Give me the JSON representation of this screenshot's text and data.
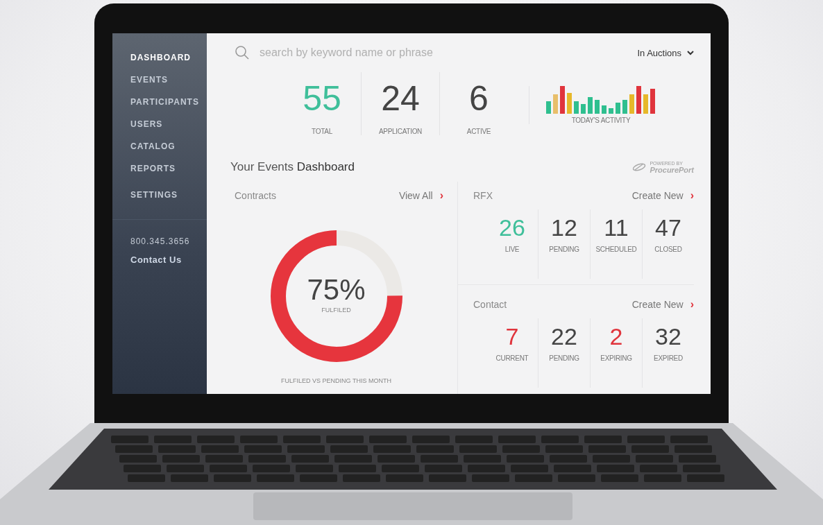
{
  "sidebar": {
    "items": [
      {
        "label": "DASHBOARD",
        "selected": true
      },
      {
        "label": "EVENTS",
        "selected": false
      },
      {
        "label": "PARTICIPANTS",
        "selected": false
      },
      {
        "label": "USERS",
        "selected": false
      },
      {
        "label": "CATALOG",
        "selected": false
      },
      {
        "label": "REPORTS",
        "selected": false
      },
      {
        "label": "SETTINGS",
        "selected": false
      }
    ],
    "phone": "800.345.3656",
    "contact_link": "Contact Us"
  },
  "search": {
    "placeholder": "search by keyword name or phrase"
  },
  "filter_dropdown": {
    "value": "In Auctions"
  },
  "summary": [
    {
      "value": "55",
      "label": "TOTAL",
      "color": "#3fbf9a"
    },
    {
      "value": "24",
      "label": "APPLICATION",
      "color": "#444444"
    },
    {
      "value": "6",
      "label": "ACTIVE",
      "color": "#444444"
    }
  ],
  "activity": {
    "label": "TODAY'S ACTIVITY"
  },
  "title": "Your Events **Dashboard**",
  "logo": {
    "tagline": "POWERED BY",
    "name": "ProcurePort"
  },
  "contracts": {
    "title": "Contracts",
    "link": "View All",
    "link_icon": "›",
    "level": 0.75,
    "percent": "75%",
    "center_label": "FULFILED",
    "caption": "FULFILED VS PENDING THIS MONTH"
  },
  "rfx": {
    "title": "RFX",
    "link": "Create New",
    "link_icon": "›",
    "stats": [
      {
        "value": "26",
        "label": "LIVE",
        "color": "#3fbf9a"
      },
      {
        "value": "12",
        "label": "PENDING",
        "color": "#444444"
      },
      {
        "value": "11",
        "label": "SCHEDULED",
        "color": "#444444"
      },
      {
        "value": "47",
        "label": "CLOSED",
        "color": "#444444"
      }
    ]
  },
  "contact": {
    "title": "Contact",
    "link": "Create New",
    "link_icon": "›",
    "stats": [
      {
        "value": "7",
        "label": "CURRENT",
        "color": "#e0343c"
      },
      {
        "value": "22",
        "label": "PENDING",
        "color": "#444444"
      },
      {
        "value": "2",
        "label": "EXPIRING",
        "color": "#e0343c"
      },
      {
        "value": "32",
        "label": "EXPIRED",
        "color": "#444444"
      }
    ]
  }
}
